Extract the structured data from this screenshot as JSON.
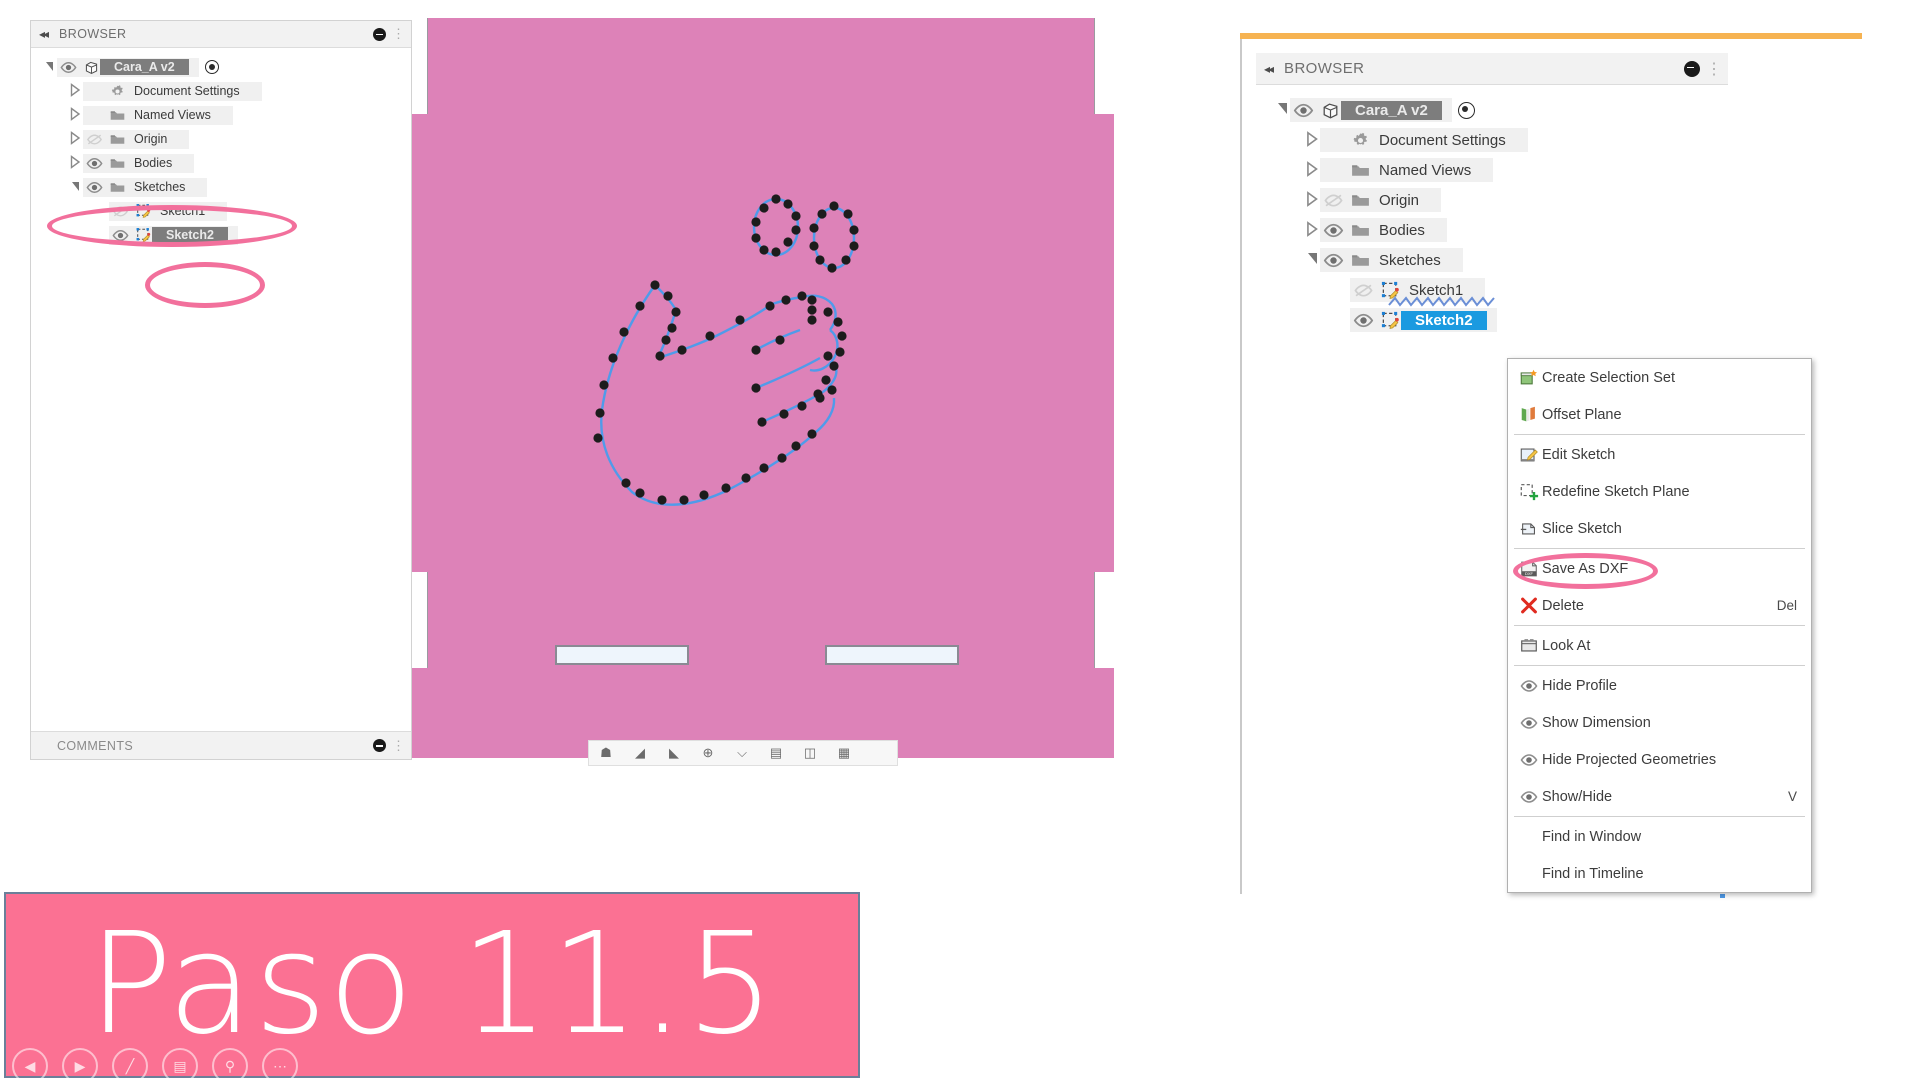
{
  "slide": {
    "banner_text": "Paso 11.5",
    "banner_color": "#fb7193",
    "annotation_color": "#f2709c"
  },
  "left_panel": {
    "header": {
      "title": "BROWSER",
      "collapse_icon": "double-left-arrow-icon"
    },
    "tree": [
      {
        "label": "Cara_A v2",
        "style": "selected-grey",
        "indent": 0,
        "eye": "eye-visible-icon",
        "expander": "triangle-open",
        "has_radio": true,
        "icon": "component-cube-icon"
      },
      {
        "label": "Document Settings",
        "style": "plain",
        "indent": 1,
        "eye": "none",
        "expander": "triangle-closed",
        "has_radio": false,
        "icon": "gear-icon"
      },
      {
        "label": "Named Views",
        "style": "plain",
        "indent": 1,
        "eye": "none",
        "expander": "triangle-closed",
        "has_radio": false,
        "icon": "folder-icon"
      },
      {
        "label": "Origin",
        "style": "plain",
        "indent": 1,
        "eye": "eye-hidden-icon",
        "expander": "triangle-closed",
        "has_radio": false,
        "icon": "folder-icon"
      },
      {
        "label": "Bodies",
        "style": "plain",
        "indent": 1,
        "eye": "eye-visible-icon",
        "expander": "triangle-closed",
        "has_radio": false,
        "icon": "folder-icon"
      },
      {
        "label": "Sketches",
        "style": "plain",
        "indent": 1,
        "eye": "eye-visible-icon",
        "expander": "triangle-open",
        "has_radio": false,
        "icon": "folder-icon"
      },
      {
        "label": "Sketch1",
        "style": "plain",
        "indent": 2,
        "eye": "eye-hidden-icon",
        "expander": "none",
        "has_radio": false,
        "icon": "sketch-icon"
      },
      {
        "label": "Sketch2",
        "style": "selected-grey",
        "indent": 2,
        "eye": "eye-visible-icon",
        "expander": "none",
        "has_radio": false,
        "icon": "sketch-icon"
      }
    ],
    "comments_header": {
      "title": "COMMENTS"
    }
  },
  "right_panel": {
    "header": {
      "title": "BROWSER",
      "collapse_icon": "double-left-arrow-icon"
    },
    "tree": [
      {
        "label": "Cara_A v2",
        "style": "selected-grey",
        "indent": 0,
        "eye": "eye-visible-icon",
        "expander": "triangle-open",
        "has_radio": true,
        "icon": "component-cube-icon"
      },
      {
        "label": "Document Settings",
        "style": "plain",
        "indent": 1,
        "eye": "none",
        "expander": "triangle-closed",
        "has_radio": false,
        "icon": "gear-icon"
      },
      {
        "label": "Named Views",
        "style": "plain",
        "indent": 1,
        "eye": "none",
        "expander": "triangle-closed",
        "has_radio": false,
        "icon": "folder-icon"
      },
      {
        "label": "Origin",
        "style": "plain",
        "indent": 1,
        "eye": "eye-hidden-icon",
        "expander": "triangle-closed",
        "has_radio": false,
        "icon": "folder-icon"
      },
      {
        "label": "Bodies",
        "style": "plain",
        "indent": 1,
        "eye": "eye-visible-icon",
        "expander": "triangle-closed",
        "has_radio": false,
        "icon": "folder-icon"
      },
      {
        "label": "Sketches",
        "style": "plain",
        "indent": 1,
        "eye": "eye-visible-icon",
        "expander": "triangle-open",
        "has_radio": false,
        "icon": "folder-icon"
      },
      {
        "label": "Sketch1",
        "style": "plain",
        "indent": 2,
        "eye": "eye-hidden-icon",
        "expander": "none",
        "has_radio": false,
        "icon": "sketch-icon"
      },
      {
        "label": "Sketch2",
        "style": "selected-blue",
        "indent": 2,
        "eye": "eye-visible-icon",
        "expander": "none",
        "has_radio": false,
        "icon": "sketch-icon"
      }
    ]
  },
  "context_menu": {
    "items": [
      {
        "label": "Create Selection Set",
        "icon": "selection-set-icon",
        "shortcut": "",
        "separator_after": false
      },
      {
        "label": "Offset Plane",
        "icon": "offset-plane-icon",
        "shortcut": "",
        "separator_after": true
      },
      {
        "label": "Edit Sketch",
        "icon": "edit-sketch-icon",
        "shortcut": "",
        "separator_after": false
      },
      {
        "label": "Redefine Sketch Plane",
        "icon": "redefine-sketch-plane-icon",
        "shortcut": "",
        "separator_after": false
      },
      {
        "label": "Slice Sketch",
        "icon": "slice-sketch-icon",
        "shortcut": "",
        "separator_after": true
      },
      {
        "label": "Save As DXF",
        "icon": "save-as-dxf-icon",
        "shortcut": "",
        "separator_after": false,
        "highlighted": true
      },
      {
        "label": "Delete",
        "icon": "delete-x-icon",
        "shortcut": "Del",
        "separator_after": true
      },
      {
        "label": "Look At",
        "icon": "look-at-icon",
        "shortcut": "",
        "separator_after": true
      },
      {
        "label": "Hide Profile",
        "icon": "eye-visible-icon",
        "shortcut": "",
        "separator_after": false
      },
      {
        "label": "Show Dimension",
        "icon": "eye-visible-icon",
        "shortcut": "",
        "separator_after": false
      },
      {
        "label": "Hide Projected Geometries",
        "icon": "eye-visible-icon",
        "shortcut": "",
        "separator_after": false
      },
      {
        "label": "Show/Hide",
        "icon": "eye-visible-icon",
        "shortcut": "V",
        "separator_after": true
      },
      {
        "label": "Find in Window",
        "icon": "none",
        "shortcut": "",
        "separator_after": false
      },
      {
        "label": "Find in Timeline",
        "icon": "none",
        "shortcut": "",
        "separator_after": false
      }
    ]
  },
  "nav_toolbar": {
    "icons": [
      "home-icon",
      "fit-icon",
      "orbit-icon",
      "look-at-icon",
      "display-settings-icon",
      "grid-snap-icon",
      "viewports-icon"
    ]
  },
  "slide_overlay": {
    "buttons": [
      "prev-slide-icon",
      "next-slide-icon",
      "pen-icon",
      "layout-icon",
      "zoom-icon",
      "more-options-icon"
    ]
  },
  "canvas": {
    "left_body_color": "#dd82b8",
    "right_body_color": "#a086c4",
    "sketch_line_color": "#4f9bea",
    "sketch_point_color": "#1c1c1c",
    "slot_count": 2
  }
}
